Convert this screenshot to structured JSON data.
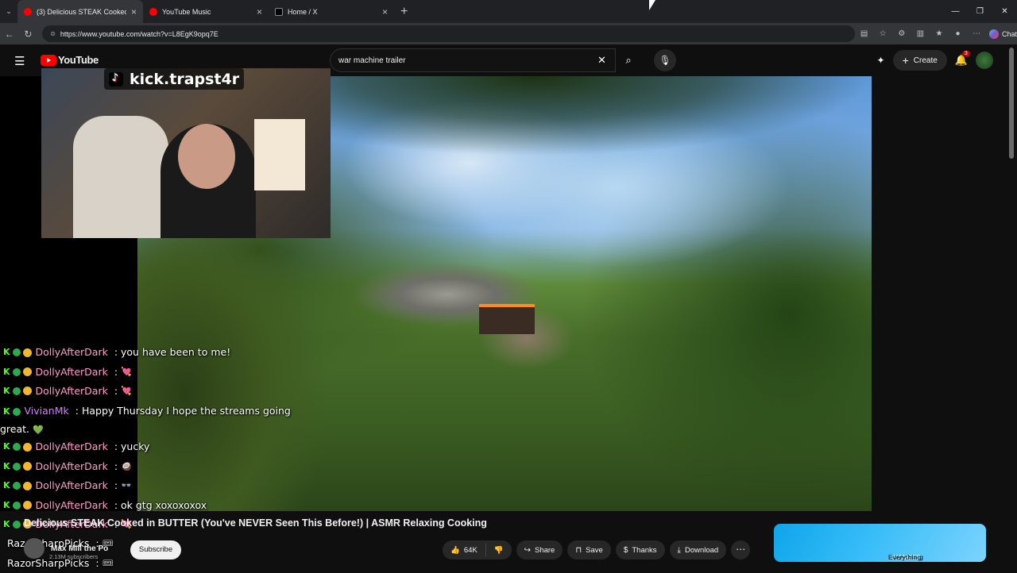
{
  "browser": {
    "tabs": [
      {
        "title": "(3) Delicious STEAK Cooked in",
        "active": true,
        "favicon_color": "#ff0000"
      },
      {
        "title": "YouTube Music",
        "active": false,
        "favicon_color": "#ff0000"
      },
      {
        "title": "Home / X",
        "active": false,
        "favicon_color": "#000000"
      }
    ],
    "url": "https://www.youtube.com/watch?v=L8EgK9opq7E",
    "chat_label": "Chat"
  },
  "youtube": {
    "logo_text": "YouTube",
    "search_value": "war machine trailer",
    "create_label": "Create",
    "notification_count": "3"
  },
  "stream_overlay": {
    "handle": "kick.trapst4r"
  },
  "chat": [
    {
      "user": "DollyAfterDark",
      "color": "#ff9ecb",
      "text": ": you have been to me!",
      "emote": "",
      "gold": true
    },
    {
      "user": "DollyAfterDark",
      "color": "#ff9ecb",
      "text": ":",
      "emote": "💘",
      "gold": true
    },
    {
      "user": "DollyAfterDark",
      "color": "#ff9ecb",
      "text": ":",
      "emote": "💘",
      "gold": true
    },
    {
      "user": "VivianMk",
      "color": "#d580ff",
      "text": ": Happy Thursday I hope the streams going great.",
      "emote": "💚",
      "gold": false,
      "wrap": true
    },
    {
      "user": "DollyAfterDark",
      "color": "#ff9ecb",
      "text": ": yucky",
      "emote": "",
      "gold": true
    },
    {
      "user": "DollyAfterDark",
      "color": "#ff9ecb",
      "text": ":",
      "emote": "🥥",
      "gold": true
    },
    {
      "user": "DollyAfterDark",
      "color": "#ff9ecb",
      "text": ":",
      "emote": "👓",
      "gold": true
    },
    {
      "user": "DollyAfterDark",
      "color": "#ff9ecb",
      "text": ": ok gtg xoxoxoxox",
      "emote": "",
      "gold": true
    },
    {
      "user": "DollyAfterDark",
      "color": "#ff9ecb",
      "text": ":",
      "emote": "💘",
      "gold": true
    },
    {
      "user": "RazorSharpPicks",
      "color": "#ffffff",
      "text": ":",
      "emote": "🎟",
      "gold": false,
      "nobadge": true
    },
    {
      "user": "RazorSharpPicks",
      "color": "#ffffff",
      "text": ":",
      "emote": "🎟",
      "gold": false,
      "nobadge": true
    }
  ],
  "video": {
    "title": "Delicious STEAK Cooked in BUTTER (You've NEVER Seen This Before!) | ASMR Relaxing Cooking",
    "channel": "Max Mill the Po",
    "subscribers": "2.13M subscribers",
    "subscribe_label": "Subscribe",
    "likes": "64K",
    "share_label": "Share",
    "save_label": "Save",
    "thanks_label": "Thanks",
    "download_label": "Download"
  },
  "ad": {
    "text_pre": "Connecting",
    "text_em": "CHANGES",
    "text_post": "Everything"
  },
  "colors": {
    "youtube_red": "#ff0000",
    "kick_green": "#53fc18",
    "bg": "#0f0f0f"
  }
}
